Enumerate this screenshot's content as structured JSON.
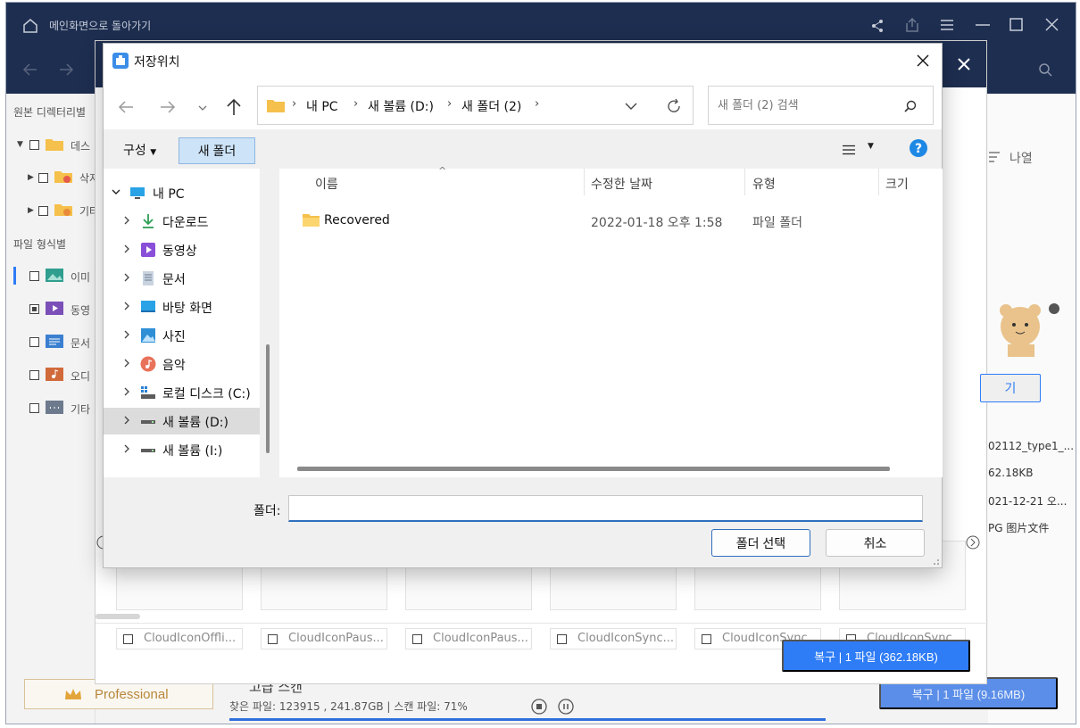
{
  "app": {
    "home_text": "메인화면으로 돌아가기",
    "sidebar": {
      "section_source": "원본 디렉터리별",
      "tree": [
        {
          "label": "데스"
        },
        {
          "label": "삭저"
        },
        {
          "label": "기타"
        }
      ],
      "section_type": "파일 형식별",
      "types": [
        {
          "label": "이미"
        },
        {
          "label": "동영"
        },
        {
          "label": "문서"
        },
        {
          "label": "오디"
        },
        {
          "label": "기타"
        }
      ],
      "professional_label": "Professional"
    },
    "right_panel": {
      "sort_label": "나열",
      "open_button": "기",
      "file_name": "02112_type1_...",
      "file_size": "62.18KB",
      "file_date": "021-12-21 오...",
      "file_type": "PG 图片文件"
    },
    "status": {
      "heading": "고급 스캔",
      "found_text": "찾은 파일: 123915 , 241.87GB | 스캔 파일: 71%",
      "recover_button": "복구 | 1 파일 (9.16MB)"
    }
  },
  "modal": {
    "thumbnails": [
      "CloudIconOffli...",
      "CloudIconPaus...",
      "CloudIconPaus...",
      "CloudIconSync...",
      "CloudIconSync...",
      "CloudIconSync..."
    ],
    "recover_button": "복구 | 1 파일 (362.18KB)"
  },
  "dialog": {
    "title": "저장위치",
    "breadcrumb": [
      "내 PC",
      "새 볼륨 (D:)",
      "새 폴더 (2)"
    ],
    "search_placeholder": "새 폴더 (2) 검색",
    "toolbar": {
      "organize": "구성",
      "new_folder": "새 폴더"
    },
    "tree": [
      {
        "label": "내 PC",
        "icon": "pc-icon"
      },
      {
        "label": "다운로드",
        "icon": "download-icon"
      },
      {
        "label": "동영상",
        "icon": "video-icon"
      },
      {
        "label": "문서",
        "icon": "document-icon"
      },
      {
        "label": "바탕 화면",
        "icon": "desktop-icon"
      },
      {
        "label": "사진",
        "icon": "pictures-icon"
      },
      {
        "label": "음악",
        "icon": "music-icon"
      },
      {
        "label": "로컬 디스크 (C:)",
        "icon": "drive-c-icon"
      },
      {
        "label": "새 볼륨 (D:)",
        "icon": "drive-icon"
      },
      {
        "label": "새 볼륨 (I:)",
        "icon": "drive-icon"
      }
    ],
    "columns": {
      "name": "이름",
      "modified": "수정한 날짜",
      "type": "유형",
      "size": "크기"
    },
    "files": [
      {
        "name": "Recovered",
        "modified": "2022-01-18 오후 1:58",
        "type": "파일 폴더",
        "size": ""
      }
    ],
    "folder_label": "폴더:",
    "folder_value": "",
    "select_button": "폴더 선택",
    "cancel_button": "취소"
  }
}
